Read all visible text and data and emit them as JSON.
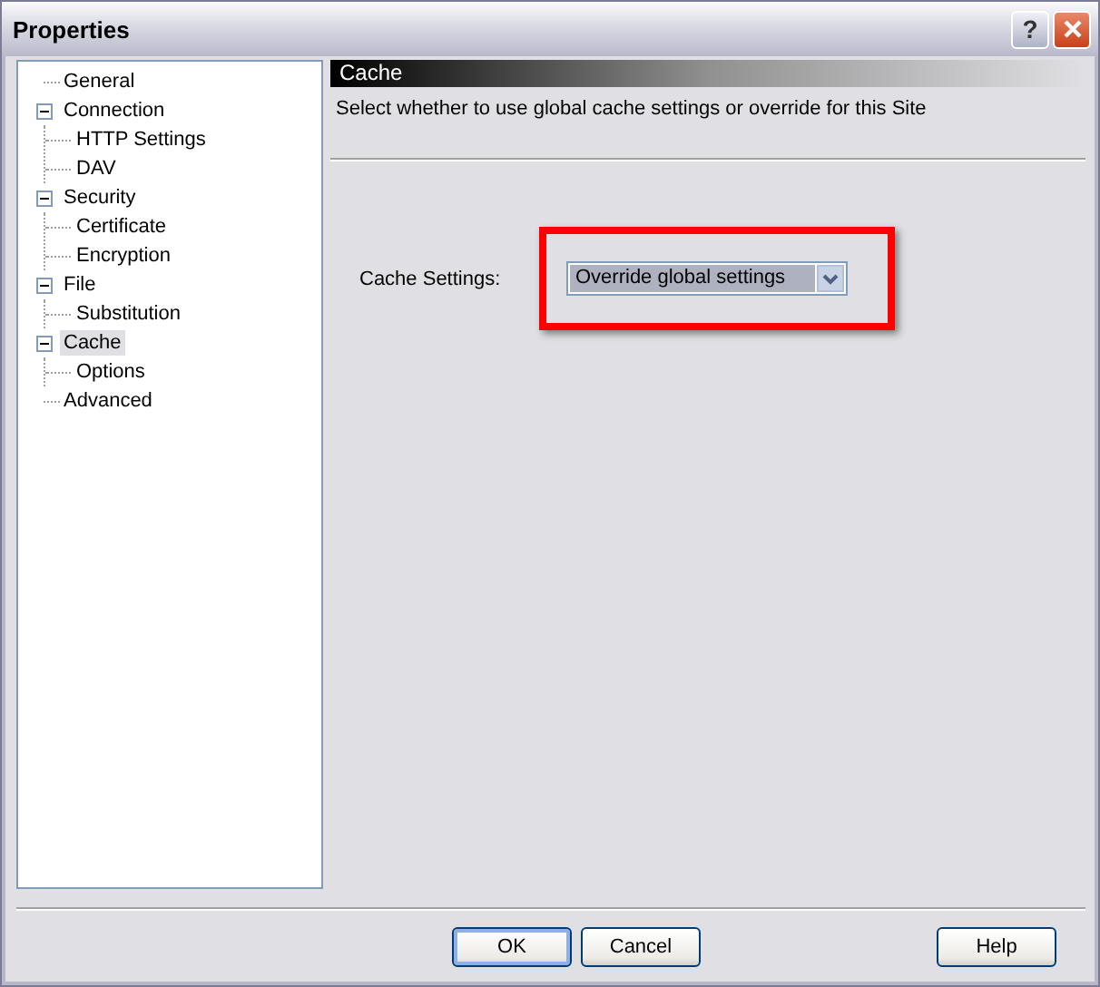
{
  "window": {
    "title": "Properties",
    "help_button": "?"
  },
  "tree": [
    {
      "label": "General",
      "selected": false
    },
    {
      "label": "Connection",
      "selected": false,
      "expanded": true,
      "children": [
        {
          "label": "HTTP Settings",
          "selected": false
        },
        {
          "label": "DAV",
          "selected": false
        }
      ]
    },
    {
      "label": "Security",
      "selected": false,
      "expanded": true,
      "children": [
        {
          "label": "Certificate",
          "selected": false
        },
        {
          "label": "Encryption",
          "selected": false
        }
      ]
    },
    {
      "label": "File",
      "selected": false,
      "expanded": true,
      "children": [
        {
          "label": "Substitution",
          "selected": false
        }
      ]
    },
    {
      "label": "Cache",
      "selected": true,
      "expanded": true,
      "children": [
        {
          "label": "Options",
          "selected": false
        }
      ]
    },
    {
      "label": "Advanced",
      "selected": false
    }
  ],
  "panel": {
    "title": "Cache",
    "description": "Select whether to use global cache settings or override for this Site",
    "setting_label": "Cache Settings:",
    "setting_value": "Override global settings"
  },
  "buttons": [
    {
      "label": "OK",
      "kind": "default"
    },
    {
      "label": "Cancel",
      "kind": "normal"
    },
    {
      "label": "Help",
      "kind": "help"
    }
  ]
}
